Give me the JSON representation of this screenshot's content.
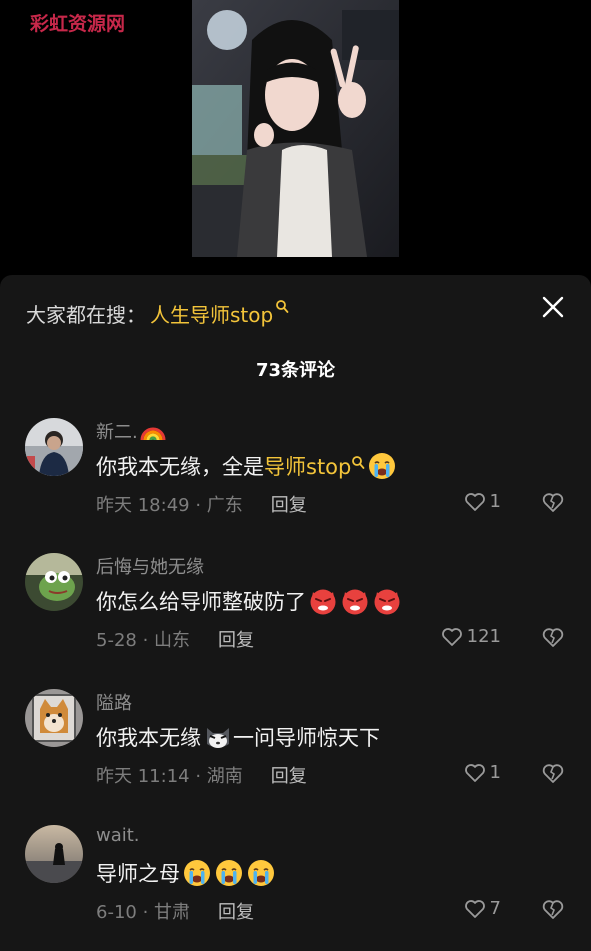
{
  "watermark": "彩虹资源网",
  "search": {
    "prefix": "大家都在搜：",
    "term": "人生导师stop"
  },
  "comments_header": {
    "count_label": "73条评论"
  },
  "comments": [
    {
      "username": "新二.",
      "text_parts": [
        "你我本无缘，全是",
        "导师stop"
      ],
      "emojis": [
        "loudly-crying-emoji"
      ],
      "time_location": "昨天 18:49 · 广东",
      "reply_label": "回复",
      "likes": "1"
    },
    {
      "username": "后悔与她无缘",
      "text": "你怎么给导师整破防了",
      "emojis": [
        "angry-devil-emoji",
        "angry-devil-emoji",
        "angry-devil-emoji"
      ],
      "time_location": "5-28 · 山东",
      "reply_label": "回复",
      "likes": "121"
    },
    {
      "username": "隘路",
      "text_before": "你我本无缘",
      "text_after": "一问导师惊天下",
      "emojis": [
        "cat-face-emoji"
      ],
      "time_location": "昨天 11:14 · 湖南",
      "reply_label": "回复",
      "likes": "1"
    },
    {
      "username": "wait.",
      "text": "导师之母",
      "emojis": [
        "loudly-crying-emoji",
        "loudly-crying-emoji",
        "loudly-crying-emoji"
      ],
      "time_location": "6-10 · 甘肃",
      "reply_label": "回复",
      "likes": "7"
    }
  ],
  "colors": {
    "background": "#000000",
    "sheet": "#161616",
    "highlight": "#f3c43a",
    "watermark": "#c7284a"
  }
}
